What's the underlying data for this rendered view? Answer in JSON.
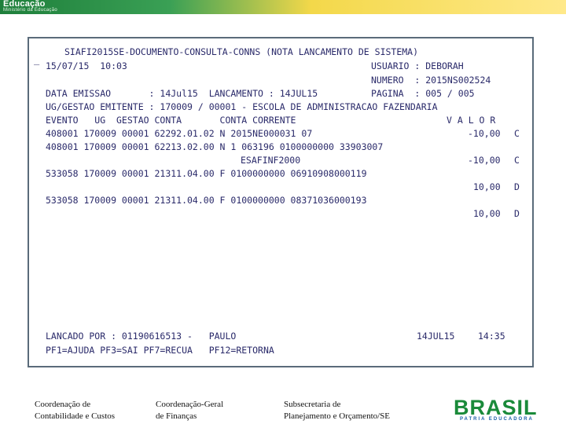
{
  "banner": {
    "title": "Educação",
    "subtitle": "Ministério da Educação"
  },
  "terminal": {
    "cursor": "_",
    "lines": {
      "title": "SIAFI2015SE-DOCUMENTO-CONSULTA-CONNS (NOTA LANCAMENTO DE SISTEMA)",
      "date_time": "15/07/15  10:03",
      "usuario": "USUARIO : DEBORAH",
      "numero": "NUMERO  : 2015NS002524",
      "emissao": "DATA EMISSAO       : 14Jul15  LANCAMENTO : 14JUL15",
      "pagina": "PAGINA  : 005 / 005",
      "ug": "UG/GESTAO EMITENTE : 170009 / 00001 - ESCOLA DE ADMINISTRACAO FAZENDARIA",
      "header": "EVENTO   UG  GESTAO CONTA       CONTA CORRENTE",
      "header_valor": "V A L O R",
      "row1": "408001 170009 00001 62292.01.02 N 2015NE000031 07",
      "row1_valor": "-10,00",
      "row1_dc": "C",
      "row2": "408001 170009 00001 62213.02.00 N 1 063196 0100000000 33903007",
      "row2b": "ESAFINF2000",
      "row2_valor": "-10,00",
      "row2_dc": "C",
      "row3": "533058 170009 00001 21311.04.00 F 0100000000 06910908000119",
      "row3_valor": "10,00",
      "row3_dc": "D",
      "row4": "533058 170009 00001 21311.04.00 F 0100000000 08371036000193",
      "row4_valor": "10,00",
      "row4_dc": "D",
      "lancado": "LANCADO POR : 01190616513 -   PAULO",
      "lancado_data": "14JUL15",
      "lancado_hora": "14:35",
      "pf_keys": "PF1=AJUDA PF3=SAI PF7=RECUA   PF12=RETORNA"
    }
  },
  "footer": {
    "col1_line1": "Coordenação de",
    "col1_line2": "Contabilidade e Custos",
    "col2_line1": "Coordenação-Geral",
    "col2_line2": "de Finanças",
    "col3_line1": "Subsecretaria de",
    "col3_line2": "Planejamento e Orçamento/SE",
    "brand": "BRASIL",
    "brand_sub": "PATRIA EDUCADORA"
  },
  "colors": {
    "terminal_text": "#2a2a6a",
    "brand_green": "#1a8a3a",
    "brand_blue": "#1a5fa8"
  }
}
